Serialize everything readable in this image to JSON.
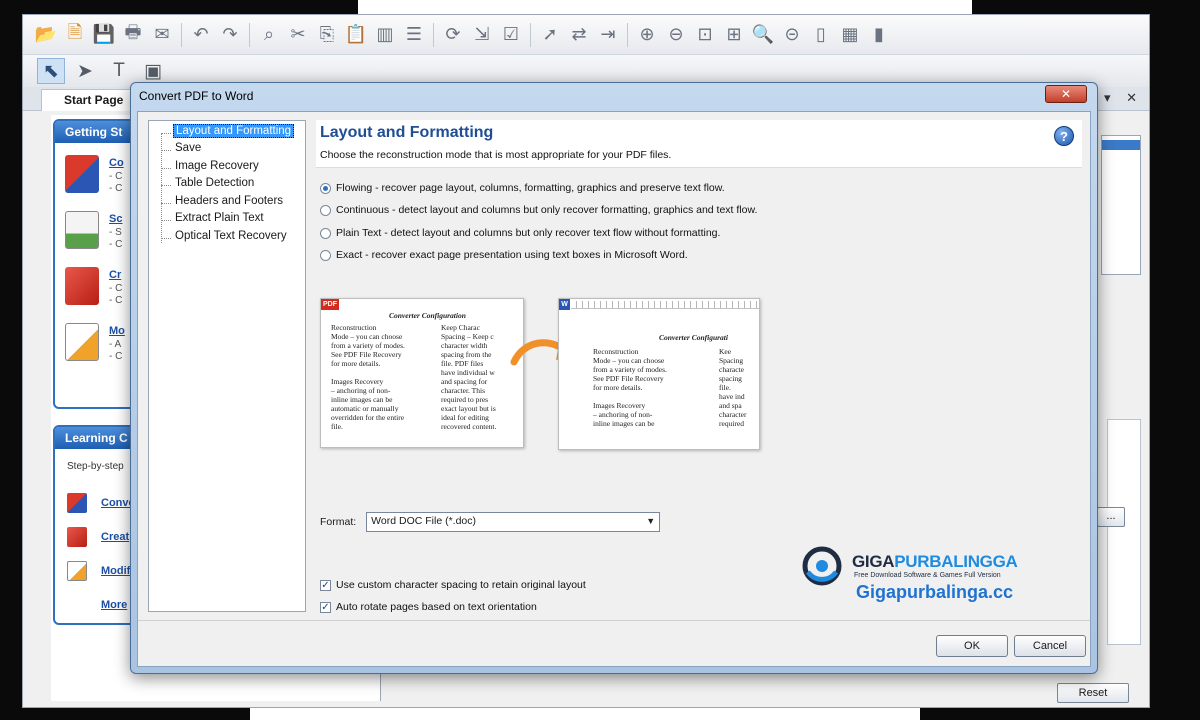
{
  "app": {
    "tab_start": "Start Page",
    "getting_started_title": "Getting St",
    "gs_items": [
      {
        "link": "Co",
        "sub": "- C\n- C"
      },
      {
        "link": "Sc",
        "sub": "- S\n- C"
      },
      {
        "link": "Cr",
        "sub": "- C\n- C"
      },
      {
        "link": "Mo",
        "sub": "- A\n- C"
      }
    ],
    "learning_title": "Learning C",
    "learning_text": "Step-by-step",
    "lc_items": [
      "Conve",
      "Creat",
      "Modifi"
    ],
    "lc_more": "More",
    "browse_label": "...",
    "reset_label": "Reset",
    "tab_controls": "▾ ✕"
  },
  "dialog": {
    "title": "Convert PDF to Word",
    "close_label": "✕",
    "nav": [
      {
        "label": "Layout and Formatting",
        "selected": true
      },
      {
        "label": "Save",
        "selected": false
      },
      {
        "label": "Image Recovery",
        "selected": false
      },
      {
        "label": "Table Detection",
        "selected": false
      },
      {
        "label": "Headers and Footers",
        "selected": false
      },
      {
        "label": "Extract Plain Text",
        "selected": false
      },
      {
        "label": "Optical Text Recovery",
        "selected": false
      }
    ],
    "heading": "Layout and Formatting",
    "description": "Choose the reconstruction mode that is most appropriate for your PDF files.",
    "modes": [
      {
        "label": "Flowing - recover page layout, columns, formatting, graphics and preserve text flow.",
        "checked": true
      },
      {
        "label": "Continuous - detect layout and columns but only recover formatting, graphics and text flow.",
        "checked": false
      },
      {
        "label": "Plain Text - detect layout and columns but only recover text flow without formatting.",
        "checked": false
      },
      {
        "label": "Exact - recover exact page presentation using text boxes in Microsoft Word.",
        "checked": false
      }
    ],
    "preview": {
      "pdf_badge": "PDF",
      "word_badge": "W",
      "heading": "Converter Configuration",
      "pdf_col1": "Reconstruction\nMode – you can choose\nfrom a variety of modes.\nSee PDF File Recovery\nfor more details.\n\nImages Recovery\n– anchoring of non-\ninline images can be\nautomatic or manually\noverridden for the entire\nfile.",
      "pdf_col2": "Keep Charac\nSpacing – Keep c\ncharacter width\nspacing from the\nfile. PDF files\nhave individual w\nand spacing for\ncharacter. This\nrequired to pres\nexact layout but is\nideal for editing\nrecovered content.",
      "word_heading": "Converter Configurati",
      "word_col1": "Reconstruction\nMode – you can choose\nfrom a variety of modes.\nSee PDF File Recovery\nfor more details.\n\nImages Recovery\n– anchoring of non-\ninline images can be",
      "word_col2": "Kee\nSpacing\ncharacte\nspacing\nfile.\nhave ind\nand spa\ncharacter\nrequired"
    },
    "format_label": "Format:",
    "format_value": "Word DOC File (*.doc)",
    "checks": [
      {
        "label": "Use custom character spacing to retain original layout",
        "checked": true
      },
      {
        "label": "Auto rotate pages based on text orientation",
        "checked": true
      }
    ],
    "ok_label": "OK",
    "cancel_label": "Cancel",
    "help_label": "?"
  },
  "watermark": {
    "brand_a": "GIGA",
    "brand_b": "PURBALINGGA",
    "tagline": "Free Download Software & Games Full Version",
    "url": "Gigapurbalinga.cc"
  },
  "colors": {
    "accent": "#1f4e96",
    "dialog_frame": "#a9c4e2",
    "selection": "#3399ff",
    "close_button": "#c3402b"
  }
}
